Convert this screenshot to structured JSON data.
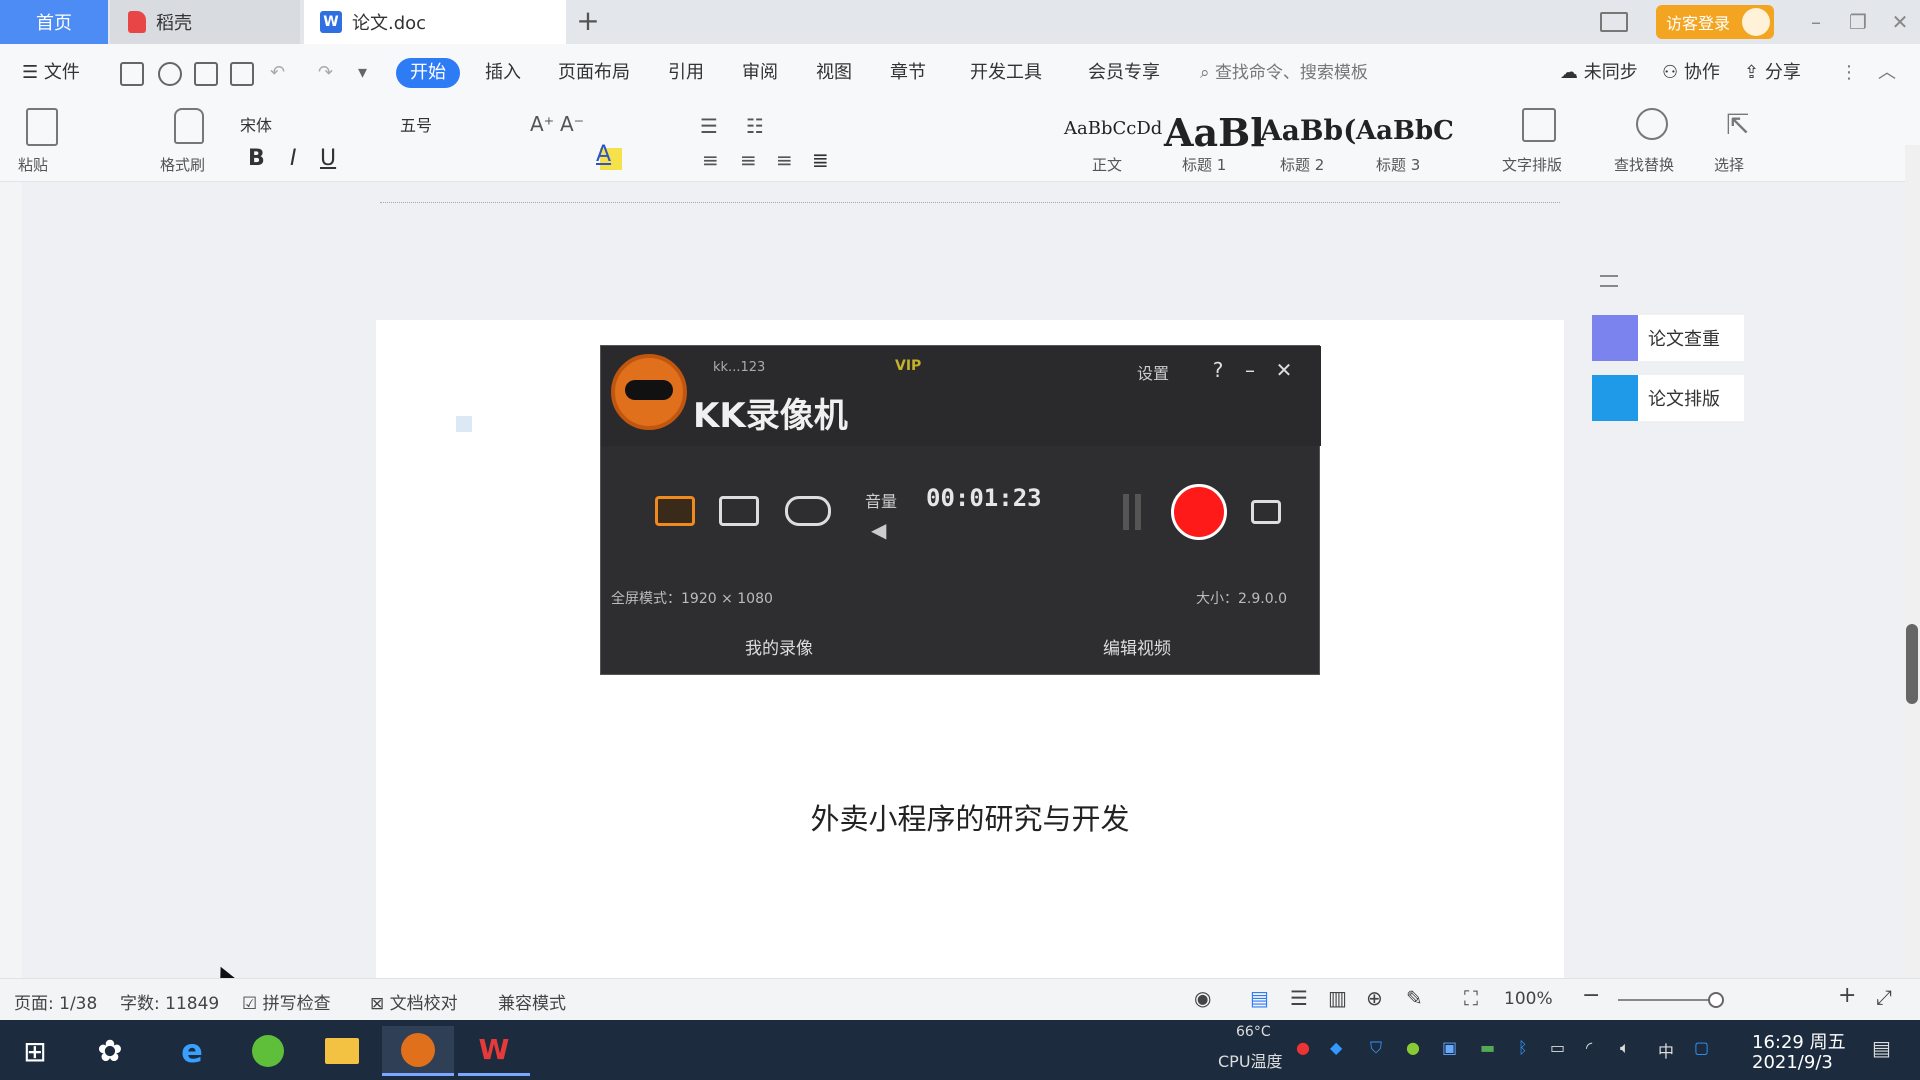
{
  "tabs": {
    "home": "首页",
    "daoke": "稻壳",
    "doc": "论文.doc",
    "add": "+"
  },
  "account": {
    "visitor_login": "访客登录"
  },
  "menu": {
    "file": "文件",
    "items": [
      "开始",
      "插入",
      "页面布局",
      "引用",
      "审阅",
      "视图",
      "章节",
      "开发工具",
      "会员专享"
    ],
    "search_placeholder": "查找命令、搜索模板",
    "sync": "未同步",
    "collab": "协作",
    "share": "分享"
  },
  "ribbon": {
    "paste": "粘贴",
    "format_painter": "格式刷",
    "font_name": "宋体",
    "font_size": "五号",
    "bold": "B",
    "italic": "I",
    "underline": "U",
    "styles": [
      {
        "sample": "AaBbCcDd",
        "label": "正文"
      },
      {
        "sample": "AaBl",
        "label": "标题 1"
      },
      {
        "sample": "AaBb(",
        "label": "标题 2"
      },
      {
        "sample": "AaBbC",
        "label": "标题 3"
      }
    ],
    "text_tools": "文字排版",
    "find_replace": "查找替换",
    "select": "选择"
  },
  "recorder": {
    "app_name": "KK录像机",
    "account": "kk...123",
    "vip": "VIP",
    "settings": "设置",
    "help": "?",
    "minimize": "–",
    "close": "✕",
    "tone_label": "音量",
    "timer": "00:01:23",
    "resolution": "全屏模式：1920 × 1080",
    "file_size": "大小：2.9.0.0",
    "my_videos": "我的录像",
    "edit_video": "编辑视频"
  },
  "document": {
    "title": "外卖小程序的研究与开发"
  },
  "side_panel": {
    "items": [
      "论文查重",
      "论文排版"
    ]
  },
  "statusbar": {
    "page": "页面: 1/38",
    "words": "字数: 11849",
    "spell_check": "拼写检查",
    "doc_check": "文档校对",
    "compat": "兼容模式",
    "zoom": "100%"
  },
  "taskbar": {
    "cpu_temp": "66°C",
    "cpu_label": "CPU温度",
    "ime": "中",
    "time": "16:29 周五",
    "date": "2021/9/3"
  },
  "colors": {
    "accent": "#2e7bf6",
    "record": "#ff1a1a",
    "visitor": "#f3a521",
    "taskbar": "#1c2b3d"
  }
}
